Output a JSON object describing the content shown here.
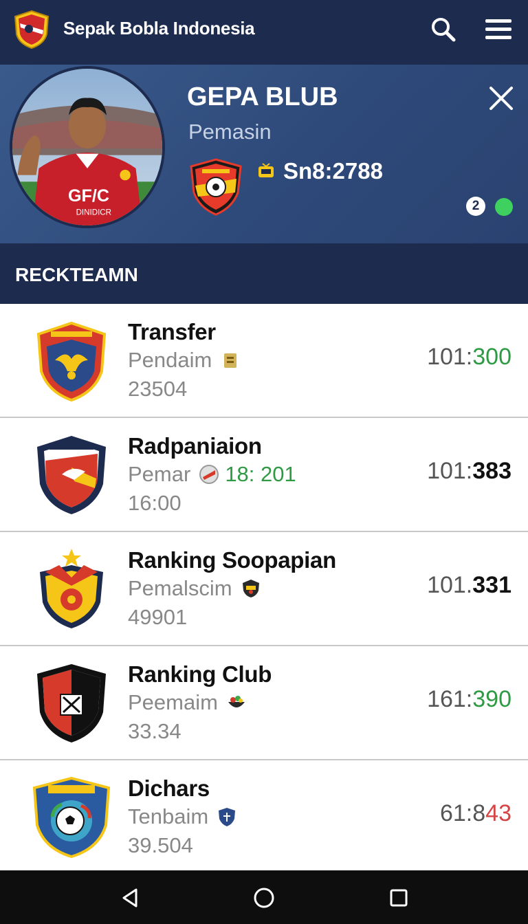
{
  "appbar": {
    "title": "Sepak Bobla Indonesia",
    "icons": [
      "shield-logo-icon",
      "search-icon",
      "menu-icon"
    ]
  },
  "profile": {
    "name": "GEPA BLUB",
    "subtitle": "Pemasin",
    "score": "Sn8:2788",
    "notification_count": "2",
    "jersey_text": "GF/C",
    "jersey_sub": "DINIDICR",
    "status_color": "#3ed160"
  },
  "section": {
    "title": "RECKTEAMN"
  },
  "rows": [
    {
      "title": "Transfer",
      "sub": "Pendaim",
      "sub_extra": "",
      "meta": "23504",
      "value_pre": "101:",
      "value_post": "300",
      "value_color": "#2e9b44",
      "value_weight": "normal"
    },
    {
      "title": "Radpaniaion",
      "sub": "Pemar",
      "sub_extra": "18: 201",
      "meta": "16:00",
      "value_pre": "101:",
      "value_post": "383",
      "value_color": "#111111",
      "value_weight": "bold"
    },
    {
      "title": "Ranking Soopapian",
      "sub": "Pemalscim",
      "sub_extra": "",
      "meta": "49901",
      "value_pre": "101.",
      "value_post": "331",
      "value_color": "#111111",
      "value_weight": "bold"
    },
    {
      "title": "Ranking Club",
      "sub": "Peemaim",
      "sub_extra": "",
      "meta": "33.34",
      "value_pre": "161:",
      "value_post": "390",
      "value_color": "#2e9b44",
      "value_weight": "normal"
    },
    {
      "title": "Dichars",
      "sub": "Tenbaim",
      "sub_extra": "",
      "meta": "39.504",
      "value_pre": "61:8",
      "value_post": "43",
      "value_color": "#d64545",
      "value_weight": "normal"
    }
  ],
  "colors": {
    "primary": "#1d2b4f",
    "profile_bg": "#35558a",
    "green": "#2e9b44",
    "red": "#d64545"
  }
}
